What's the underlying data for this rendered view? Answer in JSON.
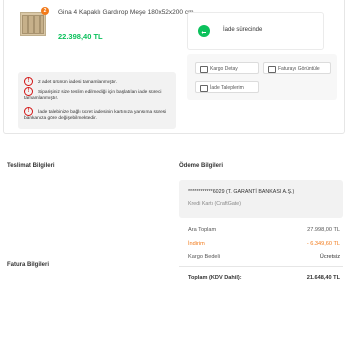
{
  "order_item": {
    "quantity_badge": "2",
    "product_title": "Gina 4 Kapaklı Gardırop Meşe 180x52x200 cm",
    "price": "22.398,40 TL",
    "notes": [
      "2 adet ürünün iadesi tamamlanmıştır.",
      "Siparişiniz size teslim edilmediği için başlatılan iade süreci tamamlanmıştır.",
      "İade talebinize bağlı ücret iadesinin kartınıza yansıma süresi bankanıza göre değişebilmektedir."
    ],
    "status_text": "İade sürecinde",
    "buttons": {
      "cargo_detail": "Kargo Detay",
      "invoice": "Faturayı Görüntüle",
      "return_requests": "İade Taleplerim"
    }
  },
  "sections": {
    "delivery_title": "Teslimat Bilgileri",
    "payment_title": "Ödeme Bilgileri",
    "invoice_title": "Fatura Bilgileri"
  },
  "payment": {
    "card_number": "************6029 (T. GARANTİ BANKASI A.Ş.)",
    "card_type": "Kredi Kartı (CraftGate)",
    "rows": [
      {
        "label": "Ara Toplam",
        "value": "27.998,00 TL"
      },
      {
        "label": "İndirim",
        "value": "- 6.349,60 TL"
      },
      {
        "label": "Kargo Bedeli",
        "value": "Ücretsiz"
      }
    ],
    "total_label": "Toplam (KDV Dahil):",
    "total_value": "21.648,40 TL"
  },
  "colors": {
    "accent_orange": "#f27a1a",
    "price_green": "#0bc15c",
    "warning_red": "#d21313",
    "discount_orange": "#f27a1a"
  },
  "icons": [
    "warning-icon",
    "return-status-icon",
    "cargo-icon",
    "invoice-icon",
    "return-requests-icon"
  ]
}
